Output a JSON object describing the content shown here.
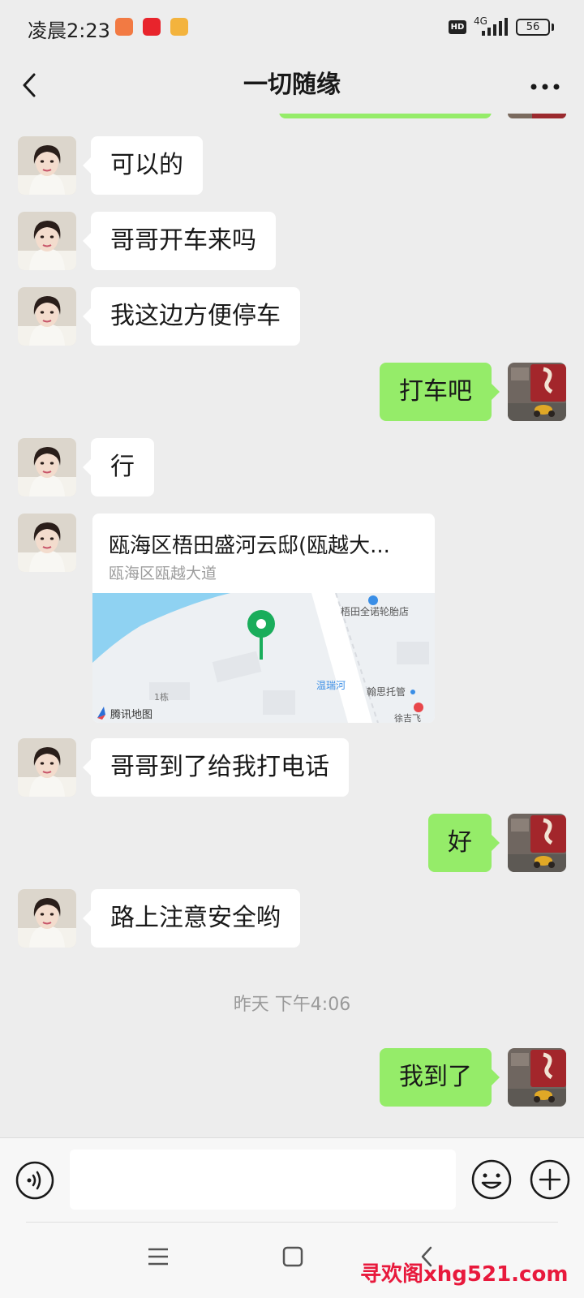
{
  "status_bar": {
    "time": "凌晨2:23",
    "hd_badge": "HD",
    "network": "4G",
    "battery": "56",
    "battery_fraction": 0.56
  },
  "header": {
    "title": "一切随缘",
    "back_icon": "chevron-left-icon",
    "more_icon": "more-dots-icon"
  },
  "messages": [
    {
      "side": "in",
      "text": "可以的"
    },
    {
      "side": "in",
      "text": "哥哥开车来吗"
    },
    {
      "side": "in",
      "text": "我这边方便停车"
    },
    {
      "side": "out",
      "text": "打车吧"
    },
    {
      "side": "in",
      "text": "行"
    },
    {
      "side": "in",
      "type": "location",
      "title": "瓯海区梧田盛河云邸(瓯越大...",
      "address": "瓯海区瓯越大道",
      "map_labels": {
        "shop": "梧田全诺轮胎店",
        "river": "温瑞河",
        "company": "翰思托管",
        "building": "1栋",
        "road": "徐吉飞",
        "provider": "腾讯地图"
      }
    },
    {
      "side": "in",
      "text": "哥哥到了给我打电话"
    },
    {
      "side": "out",
      "text": "好"
    },
    {
      "side": "in",
      "text": "路上注意安全哟"
    },
    {
      "side": "out",
      "text": "我到了"
    }
  ],
  "timestamp": "昨天 下午4:06",
  "input_bar": {
    "placeholder": "",
    "voice_icon": "voice-icon",
    "emoji_icon": "emoji-icon",
    "plus_icon": "plus-icon"
  },
  "nav_bar": {
    "menu_icon": "menu-icon",
    "home_icon": "home-icon",
    "back_icon": "back-icon"
  },
  "watermark": "寻欢阁xhg521.com",
  "colors": {
    "background": "#ededed",
    "outgoing_bubble": "#95ec69",
    "incoming_bubble": "#ffffff",
    "map_pin": "#1aad5b",
    "watermark": "#e8193c"
  }
}
